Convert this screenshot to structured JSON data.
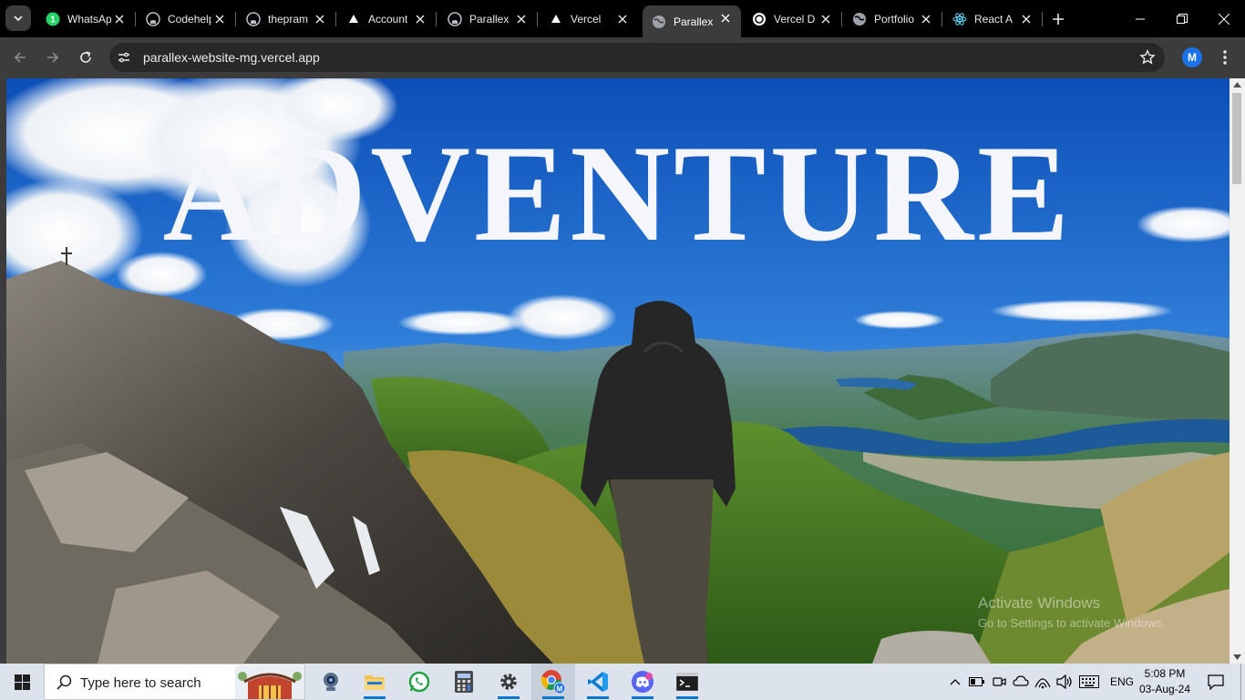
{
  "browser": {
    "tabs": [
      {
        "title": "WhatsApp",
        "icon": "whatsapp-icon",
        "badge": "1"
      },
      {
        "title": "Codehelp",
        "icon": "github-icon"
      },
      {
        "title": "thepram",
        "icon": "github-icon"
      },
      {
        "title": "Account",
        "icon": "vercel-icon"
      },
      {
        "title": "Parallex",
        "icon": "github-icon"
      },
      {
        "title": "Vercel",
        "icon": "vercel-icon"
      },
      {
        "title": "Parallex",
        "icon": "globe-icon",
        "active": true
      },
      {
        "title": "Vercel D",
        "icon": "chatgpt-icon"
      },
      {
        "title": "Portfolio",
        "icon": "globe-icon"
      },
      {
        "title": "React A",
        "icon": "react-icon"
      }
    ],
    "url": "parallex-website-mg.vercel.app",
    "profile_initial": "M"
  },
  "page": {
    "hero_title": "ADVENTURE",
    "watermark_line1": "Activate Windows",
    "watermark_line2": "Go to Settings to activate Windows."
  },
  "taskbar": {
    "search_placeholder": "Type here to search",
    "apps": [
      "webcam-icon",
      "file-explorer-icon",
      "whatsapp-icon",
      "calculator-icon",
      "settings-icon",
      "chrome-icon",
      "vscode-icon",
      "discord-icon",
      "terminal-icon"
    ],
    "language": "ENG",
    "time": "5:08 PM",
    "date": "03-Aug-24"
  },
  "colors": {
    "tabstrip": "#000000",
    "toolbar": "#3c3c3c",
    "omnibox": "#282828",
    "taskbar": "#dde3ec",
    "accent": "#1a73e8"
  }
}
